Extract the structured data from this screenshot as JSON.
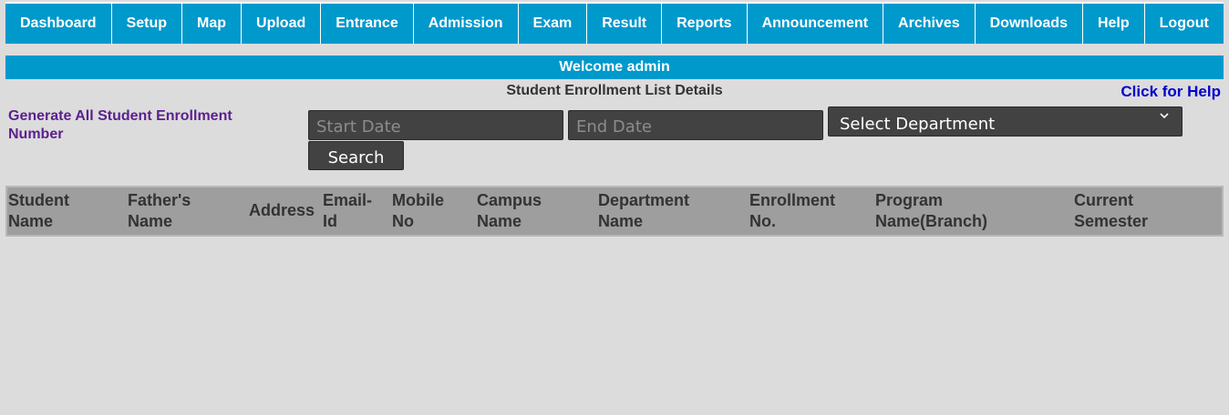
{
  "nav": {
    "items": [
      "Dashboard",
      "Setup",
      "Map",
      "Upload",
      "Entrance",
      "Admission",
      "Exam",
      "Result",
      "Reports",
      "Announcement",
      "Archives",
      "Downloads",
      "Help",
      "Logout"
    ]
  },
  "welcome": "Welcome admin",
  "page": {
    "heading": "Student Enrollment List Details",
    "help_link": "Click for Help",
    "generate_link": "Generate All Student Enrollment Number"
  },
  "form": {
    "start_date_placeholder": "Start Date",
    "end_date_placeholder": "End Date",
    "department_selected": "Select Department",
    "search_label": "Search"
  },
  "table": {
    "headers": [
      [
        "Student",
        "Name"
      ],
      [
        "Father's",
        "Name"
      ],
      [
        "Address",
        ""
      ],
      [
        "Email-",
        "Id"
      ],
      [
        "Mobile",
        "No"
      ],
      [
        "Campus",
        "Name"
      ],
      [
        "Department",
        "Name"
      ],
      [
        "Enrollment",
        "No."
      ],
      [
        "Program",
        "Name(Branch)"
      ],
      [
        "Current",
        "Semester"
      ]
    ]
  },
  "colors": {
    "nav_bg": "#0099cc",
    "page_bg": "#dcdcdc",
    "control_bg": "#424242",
    "link_help": "#0000cc",
    "link_generate": "#5b1f8f",
    "grid_header_bg": "#9e9e9e"
  }
}
